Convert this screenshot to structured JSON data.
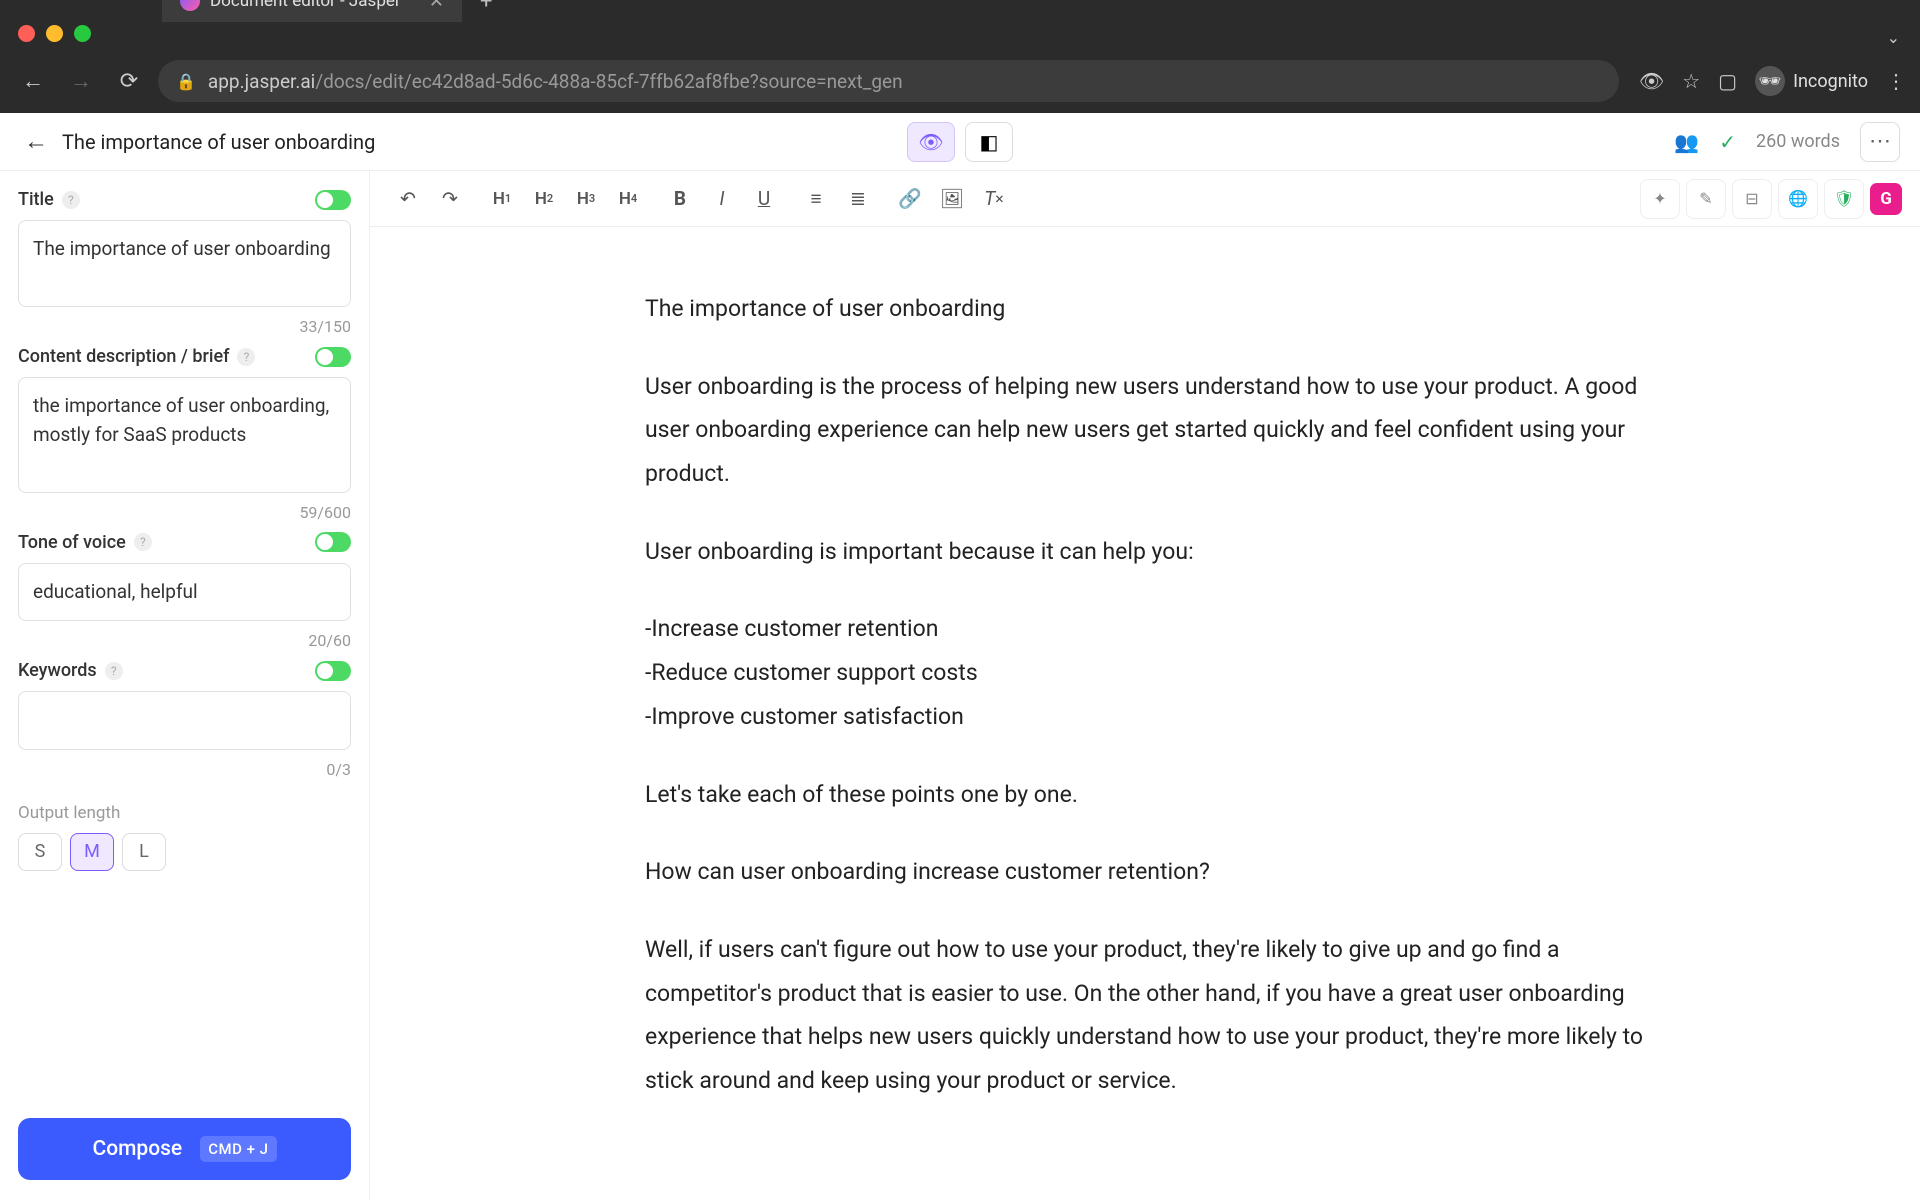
{
  "browser": {
    "tab_title": "Document editor - Jasper",
    "url_host": "app.jasper.ai",
    "url_path": "/docs/edit/ec42d8ad-5d6c-488a-85cf-7ffb62af8fbe?source=next_gen",
    "incognito_label": "Incognito"
  },
  "header": {
    "doc_title": "The importance of user onboarding",
    "word_count": "260 words"
  },
  "sidebar": {
    "title": {
      "label": "Title",
      "value": "The importance of user onboarding",
      "count": "33/150"
    },
    "brief": {
      "label": "Content description / brief",
      "value": "the importance of user onboarding, mostly for SaaS products",
      "count": "59/600"
    },
    "tone": {
      "label": "Tone of voice",
      "value": "educational, helpful",
      "count": "20/60"
    },
    "keywords": {
      "label": "Keywords",
      "value": "",
      "count": "0/3"
    },
    "output_length": {
      "label": "Output length",
      "options": {
        "s": "S",
        "m": "M",
        "l": "L"
      }
    },
    "compose": {
      "label": "Compose",
      "shortcut": "CMD + J"
    }
  },
  "document": {
    "title": "The importance of user onboarding",
    "p1": "User onboarding is the process of helping new users understand how to use your product. A good user onboarding experience can help new users get started quickly and feel confident using your product.",
    "p2": "User onboarding is important because it can help you:",
    "b1": "-Increase customer retention",
    "b2": "-Reduce customer support costs",
    "b3": "-Improve customer satisfaction",
    "p3": "Let's take each of these points one by one.",
    "p4": "How can user onboarding increase customer retention?",
    "p5": "Well, if users can't figure out how to use your product, they're likely to give up and go find a competitor's product that is easier to use. On the other hand, if you have a great user onboarding experience that helps new users quickly understand how to use your product, they're more likely to stick around and keep using your product or service."
  },
  "toolbar": {
    "headings": {
      "h1": "H",
      "h2": "H",
      "h3": "H",
      "h4": "H"
    }
  }
}
